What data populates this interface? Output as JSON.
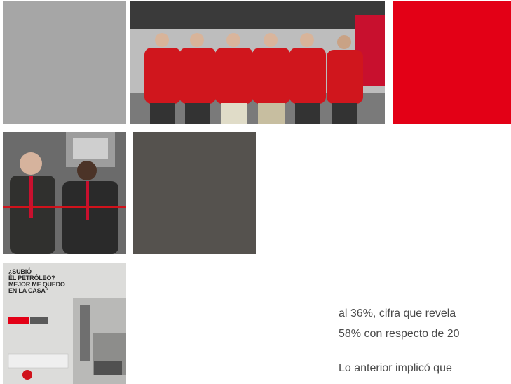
{
  "colors": {
    "gray_tile": "#a6a6a6",
    "red_tile": "#e30016",
    "dark_tile": "#55524e",
    "text": "#4a4a4a"
  },
  "poster": {
    "headline": [
      "¿SUBIÓ",
      "EL PETRÓLEO?",
      "MEJOR ME QUEDO",
      "EN LA CASA\""
    ]
  },
  "body": {
    "line_1": "al 36%, cifra que revela",
    "line_2": "58% con respecto de 20",
    "line_3": "Lo anterior implicó que"
  }
}
